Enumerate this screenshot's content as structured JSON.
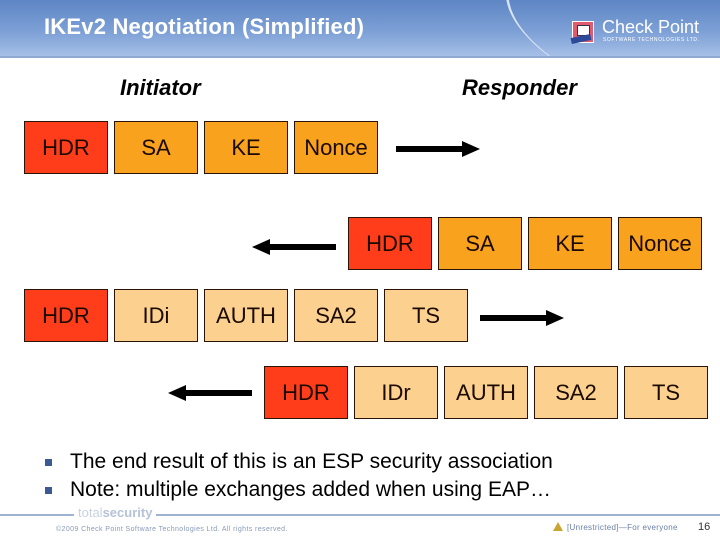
{
  "header": {
    "title": "IKEv2 Negotiation (Simplified)",
    "logo_name": "Check Point",
    "logo_subtitle": "SOFTWARE TECHNOLOGIES LTD."
  },
  "diagram": {
    "initiator_label": "Initiator",
    "responder_label": "Responder",
    "messages": [
      {
        "direction": "initiator-to-responder",
        "payloads": [
          "HDR",
          "SA",
          "KE",
          "Nonce"
        ]
      },
      {
        "direction": "responder-to-initiator",
        "payloads": [
          "HDR",
          "SA",
          "KE",
          "Nonce"
        ]
      },
      {
        "direction": "initiator-to-responder",
        "payloads": [
          "HDR",
          "IDi",
          "AUTH",
          "SA2",
          "TS"
        ]
      },
      {
        "direction": "responder-to-initiator",
        "payloads": [
          "HDR",
          "IDr",
          "AUTH",
          "SA2",
          "TS"
        ]
      }
    ],
    "colors": {
      "header_payload": "#ff3d1a",
      "init_exchange_payload": "#f9a21e",
      "auth_exchange_payload": "#fcd190",
      "arrow": "#000000"
    }
  },
  "bullets": [
    "The end result of this is an ESP security association",
    "Note: multiple exchanges added when using EAP…"
  ],
  "footer": {
    "brand_thin": "total",
    "brand_bold": "security",
    "copyright": "©2009 Check Point Software Technologies Ltd. All rights reserved.",
    "classification": "[Unrestricted]—For everyone",
    "page_number": "16"
  }
}
